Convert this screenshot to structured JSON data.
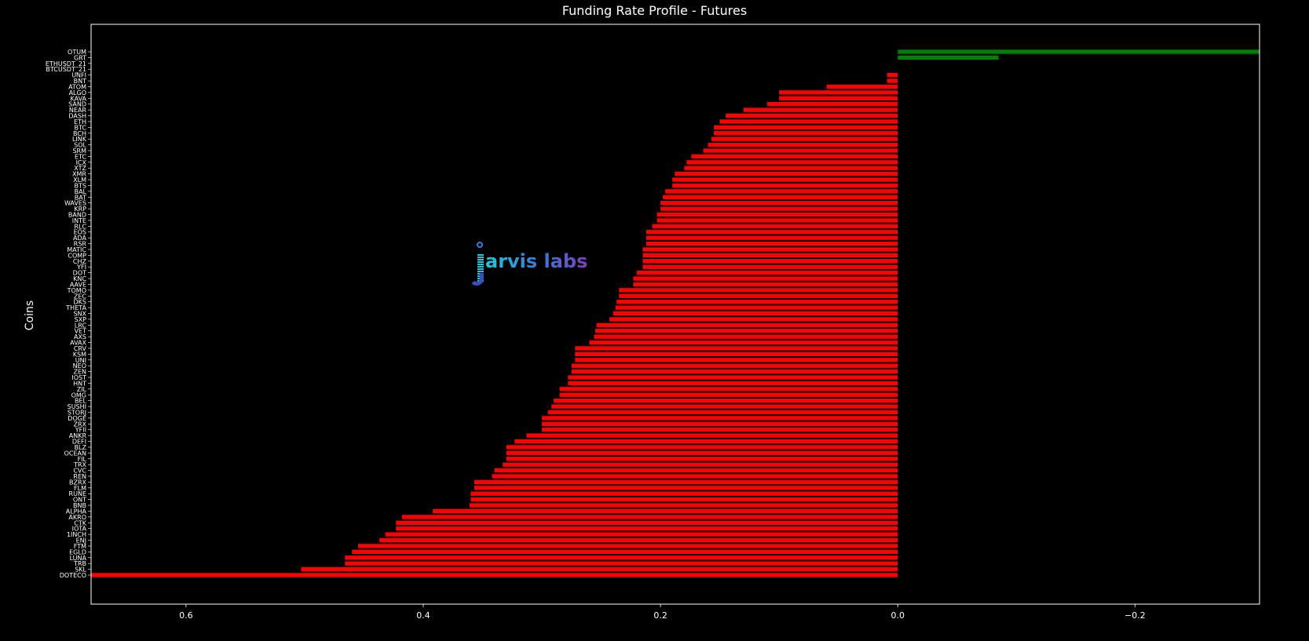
{
  "chart_data": {
    "type": "bar",
    "orientation": "horizontal",
    "title": "Funding Rate Profile - Futures",
    "xlabel": "",
    "ylabel": "Coins",
    "xlim": [
      0.68,
      -0.305
    ],
    "x_axis_inverted": true,
    "xticks": [
      "0.6",
      "0.4",
      "0.2",
      "0.0",
      "−0.2"
    ],
    "xtick_values": [
      0.6,
      0.4,
      0.2,
      0.0,
      -0.2
    ],
    "positive_color": "#ff0000",
    "negative_color": "#008000",
    "background": "#000000",
    "categories": [
      "OTUM",
      "GRT",
      "ETHUSDT_21",
      "BTCUSDT_21",
      "UNFI",
      "BNT",
      "ATOM",
      "ALGO",
      "KAVA",
      "SAND",
      "NEAR",
      "DASH",
      "ETH",
      "BTC",
      "BCH",
      "LINK",
      "SOL",
      "SRM",
      "ETC",
      "ICX",
      "XTZ",
      "XMR",
      "XLM",
      "BTS",
      "BAL",
      "BAT",
      "WAVES",
      "KRP",
      "BAND",
      "INTE",
      "RLC",
      "EOS",
      "ADA",
      "RSR",
      "MATIC",
      "COMP",
      "CHZ",
      "YFI",
      "DOT",
      "KNC",
      "AAVE",
      "TOMO",
      "ZEC",
      "DKS",
      "THETA",
      "SNX",
      "SXP",
      "LRC",
      "VET",
      "AXS",
      "AVAX",
      "CRV",
      "KSM",
      "UNI",
      "NEO",
      "ZEN",
      "IOST",
      "HNT",
      "ZIL",
      "OMG",
      "BEL",
      "SUSHI",
      "STORJ",
      "DOGE",
      "ZRX",
      "YFII",
      "ANKR",
      "DEFI",
      "BLZ",
      "OCEAN",
      "FIL",
      "TRX",
      "CVC",
      "REN",
      "BZRX",
      "FLM",
      "RUNE",
      "ONT",
      "BNB",
      "ALPHA",
      "AKRO",
      "CTK",
      "IOTA",
      "1INCH",
      "ENJ",
      "FTM",
      "EGLD",
      "LUNA",
      "TRB",
      "SKL",
      "DOTECO"
    ],
    "values": [
      -0.305,
      -0.085,
      0,
      0,
      0.009,
      0.009,
      0.06,
      0.1,
      0.1,
      0.11,
      0.13,
      0.145,
      0.15,
      0.155,
      0.155,
      0.157,
      0.16,
      0.164,
      0.174,
      0.178,
      0.18,
      0.188,
      0.19,
      0.19,
      0.196,
      0.198,
      0.2,
      0.2,
      0.203,
      0.203,
      0.207,
      0.212,
      0.212,
      0.212,
      0.215,
      0.215,
      0.215,
      0.215,
      0.22,
      0.223,
      0.223,
      0.235,
      0.235,
      0.237,
      0.238,
      0.24,
      0.243,
      0.254,
      0.255,
      0.256,
      0.26,
      0.272,
      0.272,
      0.272,
      0.275,
      0.275,
      0.278,
      0.278,
      0.285,
      0.285,
      0.29,
      0.292,
      0.295,
      0.3,
      0.3,
      0.3,
      0.313,
      0.323,
      0.33,
      0.33,
      0.33,
      0.333,
      0.34,
      0.342,
      0.357,
      0.357,
      0.36,
      0.36,
      0.361,
      0.392,
      0.418,
      0.423,
      0.423,
      0.432,
      0.437,
      0.455,
      0.46,
      0.466,
      0.466,
      0.503,
      0.68
    ]
  }
}
